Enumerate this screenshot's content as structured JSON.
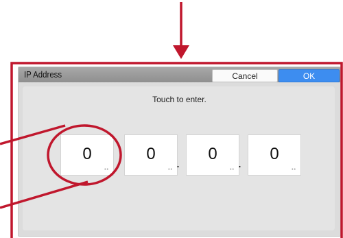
{
  "dialog": {
    "title": "IP Address",
    "cancel_label": "Cancel",
    "ok_label": "OK",
    "hint": "Touch to enter."
  },
  "ip": {
    "octets": [
      "0",
      "0",
      "0",
      "0"
    ],
    "separator": "."
  },
  "colors": {
    "annotation": "#c0172d",
    "ok_button": "#3d8df0",
    "titlebar": "#9a9a9a"
  },
  "icons": {
    "octet_indicator": "ellipsis-dots-icon"
  }
}
